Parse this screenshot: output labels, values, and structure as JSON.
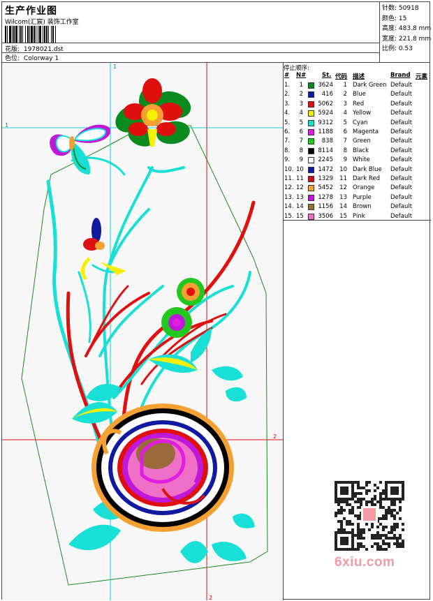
{
  "header": {
    "title": "生产作业图",
    "company": "Wilcom(汇宸) 装饰工作室",
    "file_label": "花版:",
    "file_value": "1978021.dst",
    "colorway_label": "色位:",
    "colorway_value": "Colorway 1"
  },
  "stats": [
    {
      "label": "针数:",
      "value": "50918"
    },
    {
      "label": "颜色:",
      "value": "15"
    },
    {
      "label": "高度:",
      "value": "483.8 mm"
    },
    {
      "label": "宽度:",
      "value": "221.8 mm"
    },
    {
      "label": "比例:",
      "value": "0.53"
    }
  ],
  "markers": {
    "h1": "1",
    "v1": "1",
    "h2": "2",
    "v2": "2"
  },
  "color_table": {
    "title": "停止顺序:",
    "headers": [
      "#",
      "N#",
      "St.",
      "代码",
      "描述",
      "Brand",
      "元素"
    ],
    "rows": [
      {
        "num": "1.",
        "n": "1",
        "st": "3624",
        "code": "1",
        "desc": "Dark Green",
        "brand": "Default",
        "color": "#0a8a1f"
      },
      {
        "num": "2.",
        "n": "2",
        "st": "416",
        "code": "2",
        "desc": "Blue",
        "brand": "Default",
        "color": "#0a1aa8"
      },
      {
        "num": "3.",
        "n": "3",
        "st": "5062",
        "code": "3",
        "desc": "Red",
        "brand": "Default",
        "color": "#e01010"
      },
      {
        "num": "4.",
        "n": "4",
        "st": "5924",
        "code": "4",
        "desc": "Yellow",
        "brand": "Default",
        "color": "#f5f000"
      },
      {
        "num": "5.",
        "n": "5",
        "st": "9312",
        "code": "5",
        "desc": "Cyan",
        "brand": "Default",
        "color": "#19e0d6"
      },
      {
        "num": "6.",
        "n": "6",
        "st": "1188",
        "code": "6",
        "desc": "Magenta",
        "brand": "Default",
        "color": "#e01ee0"
      },
      {
        "num": "7.",
        "n": "7",
        "st": "838",
        "code": "7",
        "desc": "Green",
        "brand": "Default",
        "color": "#22c81e"
      },
      {
        "num": "8.",
        "n": "8",
        "st": "8114",
        "code": "8",
        "desc": "Black",
        "brand": "Default",
        "color": "#000000"
      },
      {
        "num": "9.",
        "n": "9",
        "st": "2245",
        "code": "9",
        "desc": "White",
        "brand": "Default",
        "color": "#ffffff"
      },
      {
        "num": "10.",
        "n": "10",
        "st": "1472",
        "code": "10",
        "desc": "Dark Blue",
        "brand": "Default",
        "color": "#101aa0"
      },
      {
        "num": "11.",
        "n": "11",
        "st": "1329",
        "code": "11",
        "desc": "Dark Red",
        "brand": "Default",
        "color": "#c81414"
      },
      {
        "num": "12.",
        "n": "12",
        "st": "5452",
        "code": "12",
        "desc": "Orange",
        "brand": "Default",
        "color": "#f5a032"
      },
      {
        "num": "13.",
        "n": "13",
        "st": "1278",
        "code": "13",
        "desc": "Purple",
        "brand": "Default",
        "color": "#c018d8"
      },
      {
        "num": "14.",
        "n": "14",
        "st": "1156",
        "code": "14",
        "desc": "Brown",
        "brand": "Default",
        "color": "#9a6a3a"
      },
      {
        "num": "15.",
        "n": "15",
        "st": "3506",
        "code": "15",
        "desc": "Pink",
        "brand": "Default",
        "color": "#f070c8"
      }
    ]
  },
  "watermark": "6xiu.com"
}
